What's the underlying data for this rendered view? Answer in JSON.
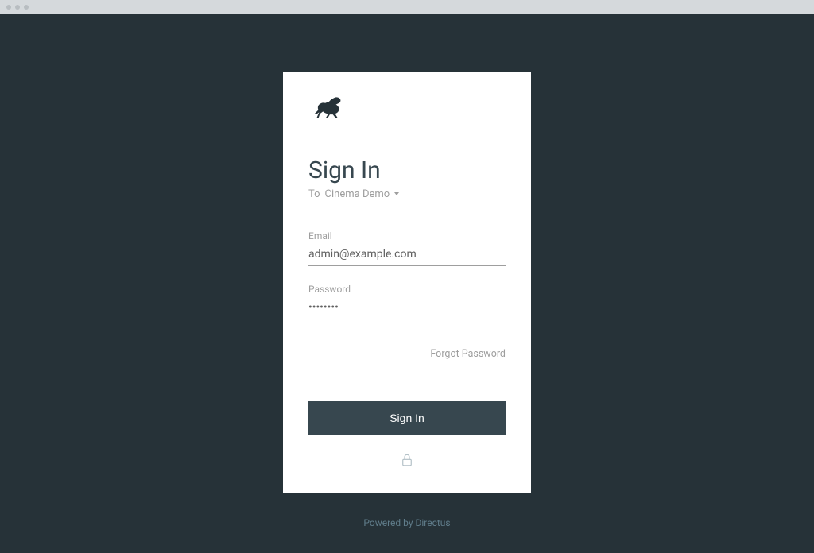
{
  "login": {
    "title": "Sign In",
    "subtitle_prefix": "To",
    "project_name": "Cinema Demo",
    "email_label": "Email",
    "email_value": "admin@example.com",
    "password_label": "Password",
    "password_value": "••••••••",
    "forgot_label": "Forgot Password",
    "submit_label": "Sign In"
  },
  "footer": {
    "text": "Powered by Directus"
  }
}
